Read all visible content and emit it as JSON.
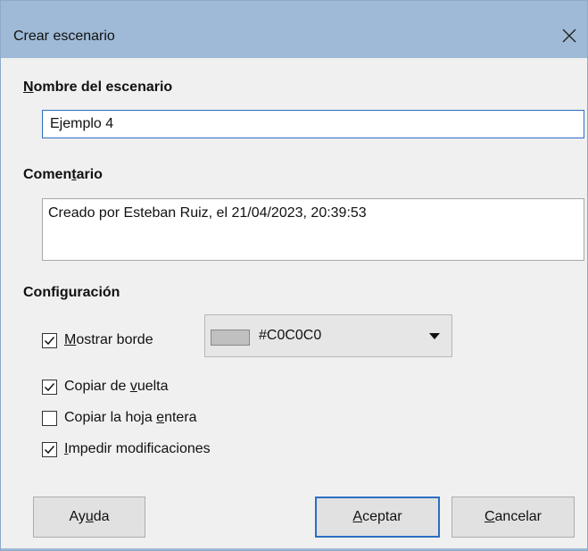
{
  "dialog": {
    "title": "Crear escenario",
    "close_icon": "close-icon"
  },
  "name_section": {
    "label_mnemonic": "N",
    "label_rest": "ombre del escenario",
    "value": "Ejemplo 4"
  },
  "comment_section": {
    "label_pre": "Comen",
    "label_mnemonic": "t",
    "label_post": "ario",
    "value": "Creado por Esteban Ruiz, el 21/04/2023, 20:39:53"
  },
  "settings": {
    "label": "Configuración",
    "show_border": {
      "pre": "",
      "mnemonic": "M",
      "post": "ostrar borde",
      "checked": true
    },
    "border_color": {
      "value": "#C0C0C0",
      "swatch": "#c0c0c0"
    },
    "copy_back": {
      "pre": "Copiar de ",
      "mnemonic": "v",
      "post": "uelta",
      "checked": true
    },
    "copy_sheet": {
      "pre": "Copiar la hoja ",
      "mnemonic": "e",
      "post": "ntera",
      "checked": false
    },
    "prevent_changes": {
      "pre": "",
      "mnemonic": "I",
      "post": "mpedir modificaciones",
      "checked": true
    }
  },
  "buttons": {
    "help_pre": "Ay",
    "help_mnemonic": "u",
    "help_post": "da",
    "ok_pre": "",
    "ok_mnemonic": "A",
    "ok_post": "ceptar",
    "cancel_pre": "",
    "cancel_mnemonic": "C",
    "cancel_post": "ancelar"
  },
  "colors": {
    "titlebar": "#9fbad6",
    "focus": "#2b6fc4",
    "background": "#f0f0f0"
  }
}
